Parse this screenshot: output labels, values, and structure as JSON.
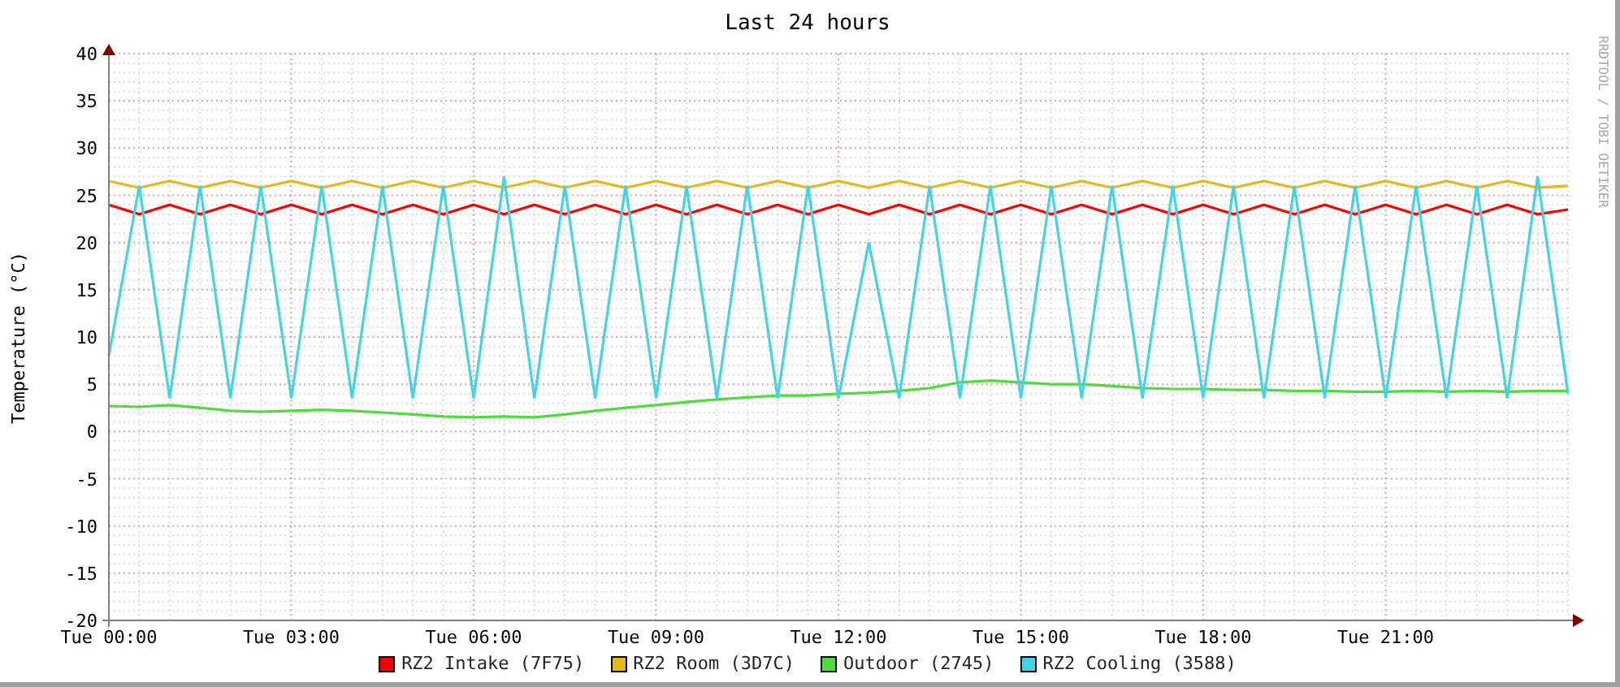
{
  "graph": {
    "credit": "RRDTOOL / TOBI OETIKER",
    "chart_data": {
      "type": "line",
      "title": "Last 24 hours",
      "ylabel": "Temperature (°C)",
      "categories": [
        "Tue 00:00",
        null,
        null,
        null,
        null,
        null,
        "Tue 03:00",
        null,
        null,
        null,
        null,
        null,
        "Tue 06:00",
        null,
        null,
        null,
        null,
        null,
        "Tue 09:00",
        null,
        null,
        null,
        null,
        null,
        "Tue 12:00",
        null,
        null,
        null,
        null,
        null,
        "Tue 15:00",
        null,
        null,
        null,
        null,
        null,
        "Tue 18:00",
        null,
        null,
        null,
        null,
        null,
        "Tue 21:00",
        null,
        null,
        null,
        null,
        null,
        null
      ],
      "ylim": [
        -20,
        40
      ],
      "grid": true,
      "yticks": [
        -20,
        -15,
        -10,
        -5,
        0,
        5,
        10,
        15,
        20,
        25,
        30,
        35,
        40
      ],
      "series": [
        {
          "name": "RZ2 Intake (7F75)",
          "color": "#ff0000",
          "values": [
            24,
            23,
            24,
            23,
            24,
            23,
            24,
            23,
            24,
            23,
            24,
            23,
            24,
            23,
            24,
            23,
            24,
            23,
            24,
            23,
            24,
            23,
            24,
            23,
            24,
            23,
            24,
            23,
            24,
            23,
            24,
            23,
            24,
            23,
            24,
            23,
            24,
            23,
            24,
            23,
            24,
            23,
            24,
            23,
            24,
            23,
            24,
            23,
            23.5
          ]
        },
        {
          "name": "RZ2 Room (3D7C)",
          "color": "#e6b61c",
          "values": [
            26.5,
            25.8,
            26.5,
            25.8,
            26.5,
            25.8,
            26.5,
            25.8,
            26.5,
            25.8,
            26.5,
            25.8,
            26.5,
            25.8,
            26.5,
            25.8,
            26.5,
            25.8,
            26.5,
            25.8,
            26.5,
            25.8,
            26.5,
            25.8,
            26.5,
            25.8,
            26.5,
            25.8,
            26.5,
            25.8,
            26.5,
            25.8,
            26.5,
            25.8,
            26.5,
            25.8,
            26.5,
            25.8,
            26.5,
            25.8,
            26.5,
            25.8,
            26.5,
            25.8,
            26.5,
            25.8,
            26.5,
            25.8,
            26
          ]
        },
        {
          "name": "Outdoor (2745)",
          "color": "#4fdb3c",
          "values": [
            2.7,
            2.6,
            2.8,
            2.5,
            2.2,
            2.1,
            2.2,
            2.3,
            2.2,
            2,
            1.8,
            1.6,
            1.5,
            1.6,
            1.5,
            1.8,
            2.2,
            2.5,
            2.8,
            3.1,
            3.4,
            3.6,
            3.8,
            3.8,
            4,
            4.1,
            4.3,
            4.6,
            5.2,
            5.4,
            5.2,
            5,
            5,
            4.8,
            4.6,
            4.5,
            4.5,
            4.4,
            4.4,
            4.3,
            4.3,
            4.2,
            4.2,
            4.3,
            4.2,
            4.3,
            4.2,
            4.3,
            4.3
          ]
        },
        {
          "name": "RZ2 Cooling (3588)",
          "color": "#43d3e6",
          "values": [
            8,
            26,
            3.5,
            26,
            3.5,
            26,
            3.5,
            26,
            3.5,
            26,
            3.5,
            26,
            3.5,
            27,
            3.5,
            26,
            3.5,
            26,
            3.5,
            26,
            3.5,
            26,
            3.5,
            26,
            3.5,
            20,
            3.5,
            26,
            3.5,
            26,
            3.5,
            26,
            3.5,
            26,
            3.5,
            26,
            3.5,
            26,
            3.5,
            26,
            3.5,
            26,
            3.5,
            26,
            3.5,
            26,
            3.5,
            27,
            4
          ]
        }
      ]
    }
  }
}
